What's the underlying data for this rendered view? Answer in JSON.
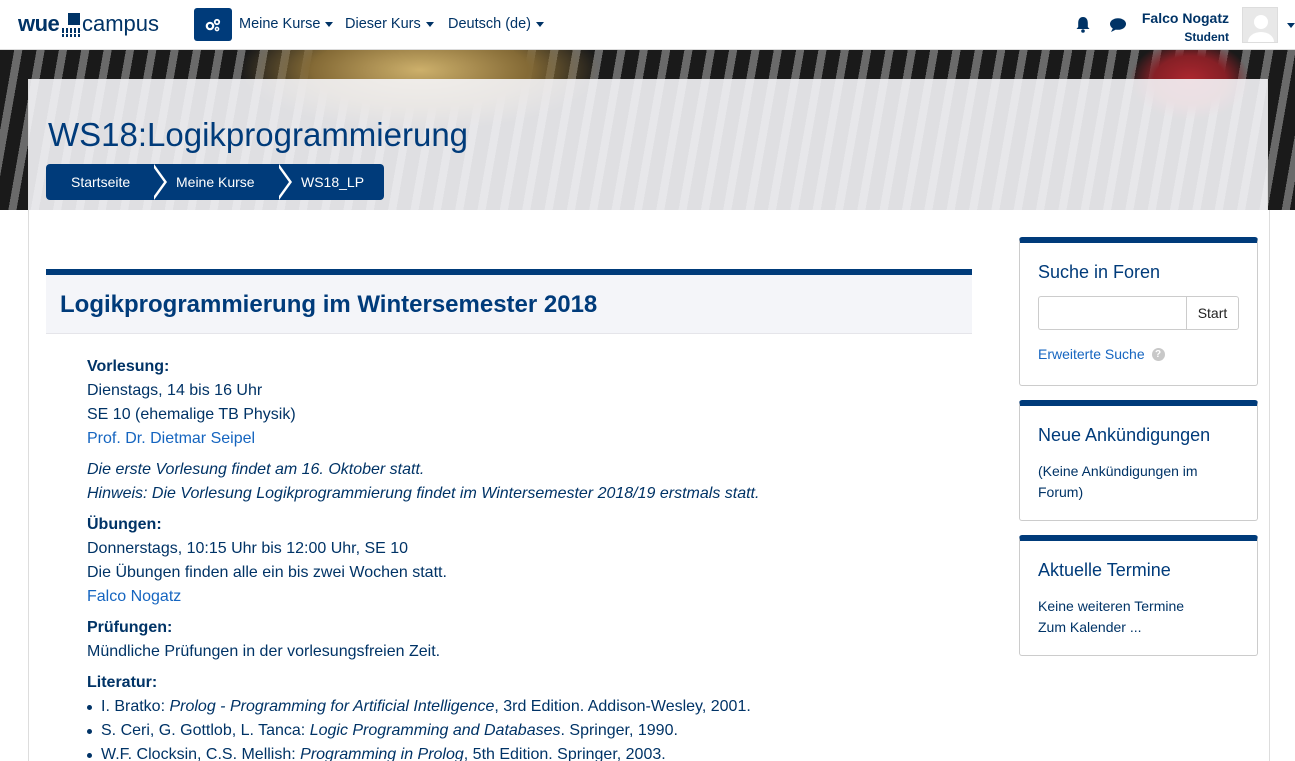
{
  "navbar": {
    "logo_primary": "wue",
    "logo_secondary": "campus",
    "menu": [
      {
        "label": "Meine Kurse"
      },
      {
        "label": "Dieser Kurs"
      },
      {
        "label": "Deutsch (de)"
      }
    ],
    "user": {
      "name": "Falco Nogatz",
      "role": "Student"
    }
  },
  "header": {
    "course_title": "WS18:Logikprogrammierung",
    "breadcrumb": [
      "Startseite",
      "Meine Kurse",
      "WS18_LP"
    ]
  },
  "section": {
    "title": "Logikprogrammierung im Wintersemester 2018",
    "vorlesung": {
      "heading": "Vorlesung:",
      "time": "Dienstags, 14 bis 16 Uhr",
      "room": "SE 10 (ehemalige TB Physik)",
      "lecturer": "Prof. Dr. Dietmar Seipel",
      "note1": "Die erste Vorlesung findet am 16. Oktober statt.",
      "note2": "Hinweis: Die Vorlesung Logikprogrammierung findet im Wintersemester 2018/19 erstmals statt."
    },
    "uebungen": {
      "heading": "Übungen:",
      "time": "Donnerstags, 10:15 Uhr bis 12:00 Uhr, SE 10",
      "note": "Die Übungen finden alle ein bis zwei Wochen statt.",
      "tutor": "Falco Nogatz"
    },
    "pruefungen": {
      "heading": "Prüfungen:",
      "text": "Mündliche Prüfungen in der vorlesungsfreien Zeit."
    },
    "literatur": {
      "heading": "Literatur:",
      "items": [
        {
          "authors": "I. Bratko: ",
          "title": "Prolog - Programming for Artificial Intelligence",
          "rest": ", 3rd Edition. Addison-Wesley, 2001."
        },
        {
          "authors": "S. Ceri, G. Gottlob, L. Tanca: ",
          "title": "Logic Programming and Databases",
          "rest": ". Springer, 1990."
        },
        {
          "authors": "W.F. Clocksin, C.S. Mellish: ",
          "title": "Programming in Prolog",
          "rest": ", 5th Edition. Springer, 2003."
        }
      ]
    }
  },
  "sidebar": {
    "forum_search": {
      "title": "Suche in Foren",
      "button": "Start",
      "advanced_link": "Erweiterte Suche",
      "input_value": ""
    },
    "announcements": {
      "title": "Neue Ankündigungen",
      "text": "(Keine Ankündigungen im Forum)"
    },
    "events": {
      "title": "Aktuelle Termine",
      "text": "Keine weiteren Termine",
      "link": "Zum Kalender ..."
    }
  },
  "colors": {
    "primary": "#003b7a",
    "text": "#003366",
    "link": "#1565c0"
  },
  "icons": [
    "gear-icon",
    "bell-icon",
    "chat-icon",
    "avatar-icon",
    "help-icon"
  ]
}
